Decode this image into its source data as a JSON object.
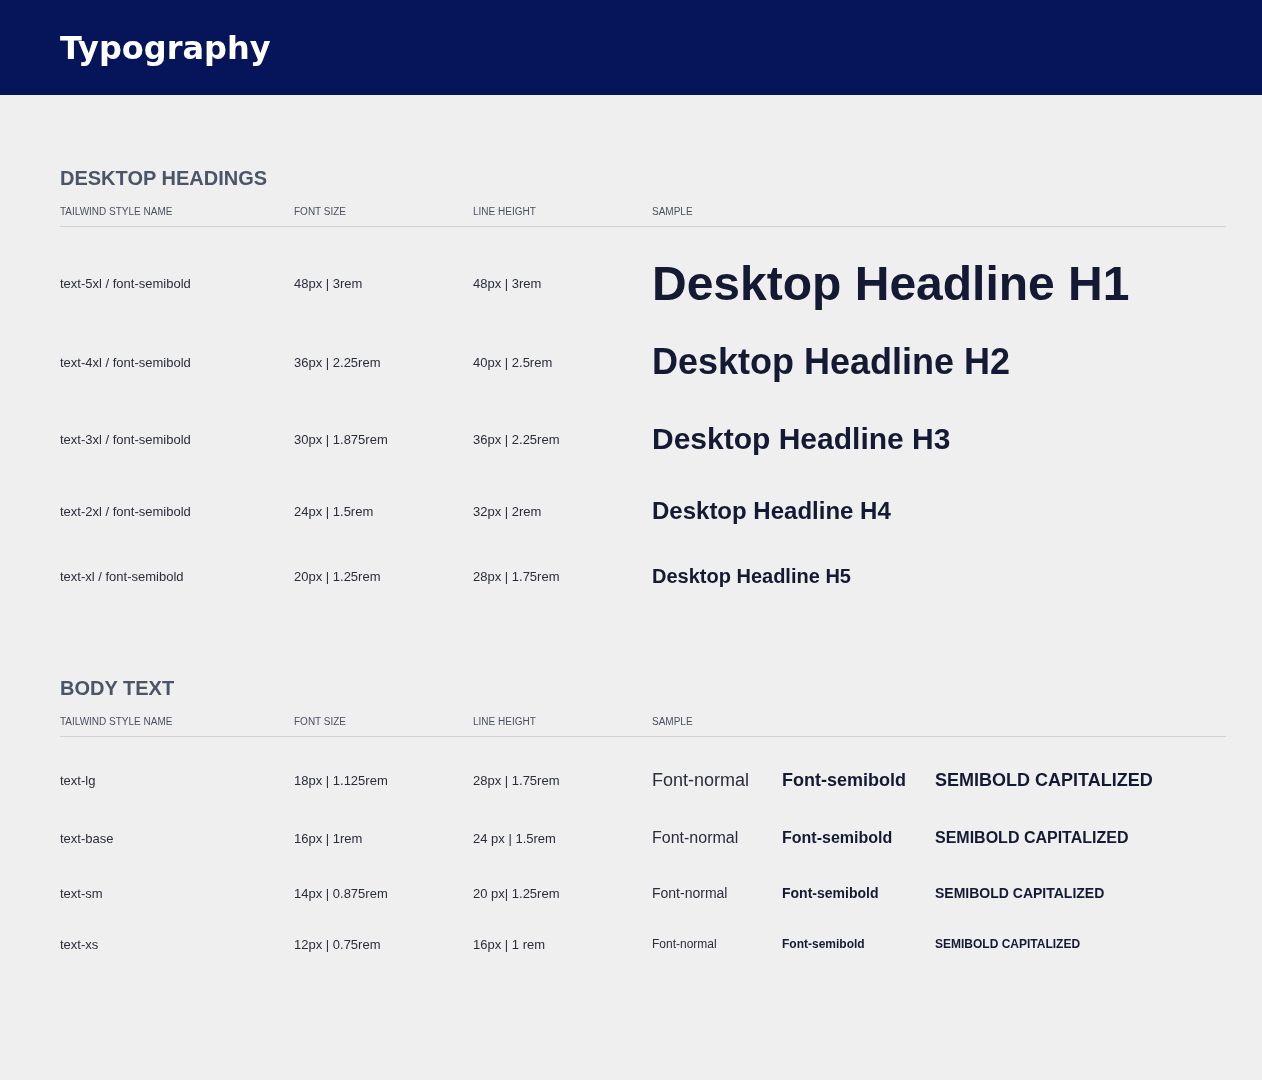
{
  "header": {
    "title": "Typography"
  },
  "sections": [
    {
      "title": "DESKTOP HEADINGS",
      "kind": "headings",
      "columns": [
        "TAILWIND STYLE NAME",
        "FONT SIZE",
        "LINE HEIGHT",
        "SAMPLE"
      ],
      "rows": [
        {
          "kind": "h1",
          "style_name": "text-5xl / font-semibold",
          "font_size": "48px | 3rem",
          "line_height": "48px | 3rem",
          "samples": [
            {
              "kind": "semibold",
              "text": "Desktop Headline H1"
            }
          ]
        },
        {
          "kind": "h2",
          "style_name": "text-4xl / font-semibold",
          "font_size": "36px | 2.25rem",
          "line_height": "40px | 2.5rem",
          "samples": [
            {
              "kind": "semibold",
              "text": "Desktop Headline H2"
            }
          ]
        },
        {
          "kind": "h3",
          "style_name": "text-3xl / font-semibold",
          "font_size": "30px | 1.875rem",
          "line_height": "36px | 2.25rem",
          "samples": [
            {
              "kind": "semibold",
              "text": "Desktop Headline H3"
            }
          ]
        },
        {
          "kind": "h4",
          "style_name": "text-2xl / font-semibold",
          "font_size": "24px | 1.5rem",
          "line_height": "32px | 2rem",
          "samples": [
            {
              "kind": "semibold",
              "text": "Desktop Headline H4"
            }
          ]
        },
        {
          "kind": "h5",
          "style_name": "text-xl / font-semibold",
          "font_size": "20px | 1.25rem",
          "line_height": "28px | 1.75rem",
          "samples": [
            {
              "kind": "semibold",
              "text": "Desktop Headline H5"
            }
          ]
        }
      ]
    },
    {
      "title": "BODY TEXT",
      "kind": "body",
      "columns": [
        "TAILWIND STYLE NAME",
        "FONT SIZE",
        "LINE HEIGHT",
        "SAMPLE"
      ],
      "rows": [
        {
          "kind": "lg",
          "style_name": "text-lg",
          "font_size": "18px | 1.125rem",
          "line_height": "28px | 1.75rem",
          "samples": [
            {
              "kind": "normal",
              "text": "Font-normal"
            },
            {
              "kind": "semibold",
              "text": "Font-semibold"
            },
            {
              "kind": "caps",
              "text": "SEMIBOLD CAPITALIZED"
            }
          ]
        },
        {
          "kind": "base",
          "style_name": "text-base",
          "font_size": "16px | 1rem",
          "line_height": "24 px | 1.5rem",
          "samples": [
            {
              "kind": "normal",
              "text": "Font-normal"
            },
            {
              "kind": "semibold",
              "text": "Font-semibold"
            },
            {
              "kind": "caps",
              "text": "SEMIBOLD CAPITALIZED"
            }
          ]
        },
        {
          "kind": "sm",
          "style_name": "text-sm",
          "font_size": "14px | 0.875rem",
          "line_height": "20 px| 1.25rem",
          "samples": [
            {
              "kind": "normal",
              "text": "Font-normal"
            },
            {
              "kind": "semibold",
              "text": "Font-semibold"
            },
            {
              "kind": "caps",
              "text": "SEMIBOLD CAPITALIZED"
            }
          ]
        },
        {
          "kind": "xs",
          "style_name": "text-xs",
          "font_size": "12px | 0.75rem",
          "line_height": "16px | 1 rem",
          "samples": [
            {
              "kind": "normal",
              "text": "Font-normal"
            },
            {
              "kind": "semibold",
              "text": "Font-semibold"
            },
            {
              "kind": "caps",
              "text": "SEMIBOLD CAPITALIZED"
            }
          ]
        }
      ]
    }
  ]
}
